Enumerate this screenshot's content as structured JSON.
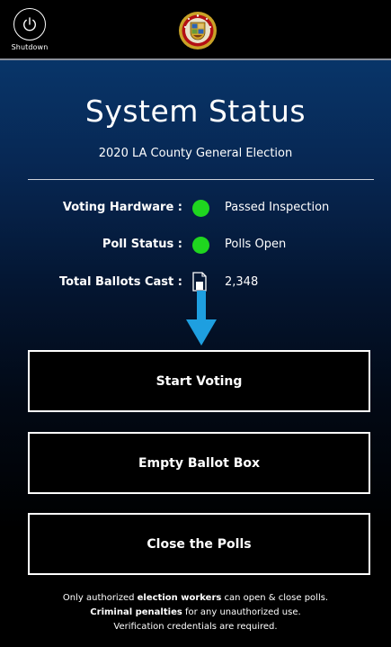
{
  "header": {
    "shutdown_label": "Shutdown",
    "shutdown_icon": "power-icon",
    "seal_icon": "county-seal-icon"
  },
  "main": {
    "title": "System Status",
    "subtitle": "2020 LA County General Election",
    "status_rows": [
      {
        "label": "Voting Hardware :",
        "indicator": "green-dot",
        "value": "Passed Inspection"
      },
      {
        "label": "Poll Status :",
        "indicator": "green-dot",
        "value": "Polls Open"
      },
      {
        "label": "Total Ballots Cast :",
        "indicator": "ballot-icon",
        "value": "2,348"
      }
    ],
    "arrow_icon": "down-arrow-icon"
  },
  "actions": {
    "start_voting": "Start Voting",
    "empty_ballot_box": "Empty Ballot Box",
    "close_polls": "Close the Polls"
  },
  "notice": {
    "line1_pre": "Only authorized ",
    "line1_bold": "election workers",
    "line1_post": " can open & close polls.",
    "line2_bold": "Criminal penalties",
    "line2_post": " for any unauthorized use.",
    "line3": "Verification credentials are required."
  },
  "colors": {
    "status_ok": "#1fd61f",
    "arrow": "#1e9fe0",
    "panel_top": "#083569",
    "panel_bottom": "#000000"
  }
}
